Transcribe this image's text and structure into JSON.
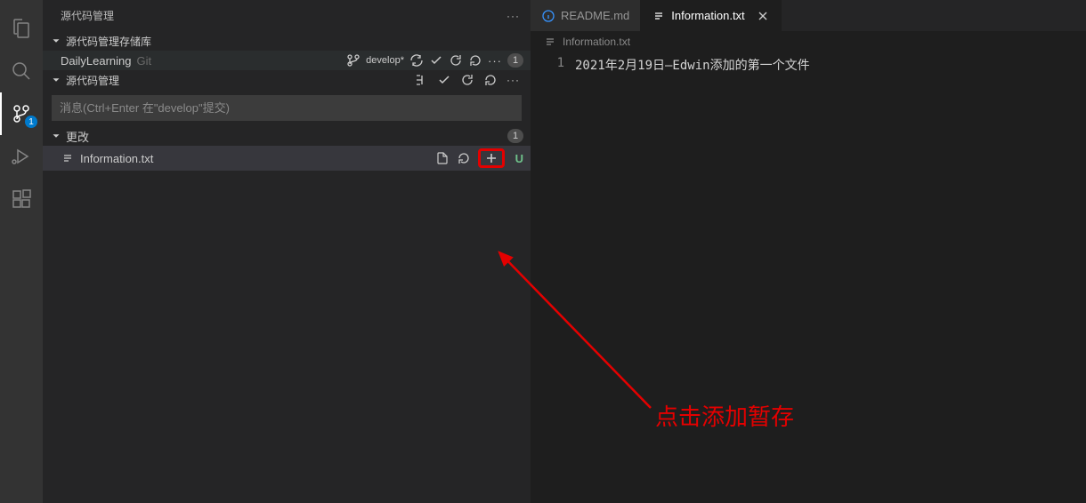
{
  "activity": {
    "scm_badge": "1"
  },
  "sidebar": {
    "title": "源代码管理",
    "sections": {
      "repos_title": "源代码管理存储库",
      "scm_title": "源代码管理"
    },
    "repo": {
      "name": "DailyLearning",
      "provider": "Git",
      "branch": "develop*",
      "count": "1"
    },
    "commit_placeholder": "消息(Ctrl+Enter 在\"develop\"提交)",
    "changes": {
      "title": "更改",
      "count": "1",
      "file": {
        "name": "Information.txt",
        "status": "U"
      }
    }
  },
  "tabs": {
    "readme": "README.md",
    "info": "Information.txt"
  },
  "breadcrumb": {
    "file": "Information.txt"
  },
  "editor": {
    "line_number": "1",
    "line_content": "2021年2月19日—Edwin添加的第一个文件"
  },
  "annotation": {
    "text": "点击添加暂存"
  }
}
